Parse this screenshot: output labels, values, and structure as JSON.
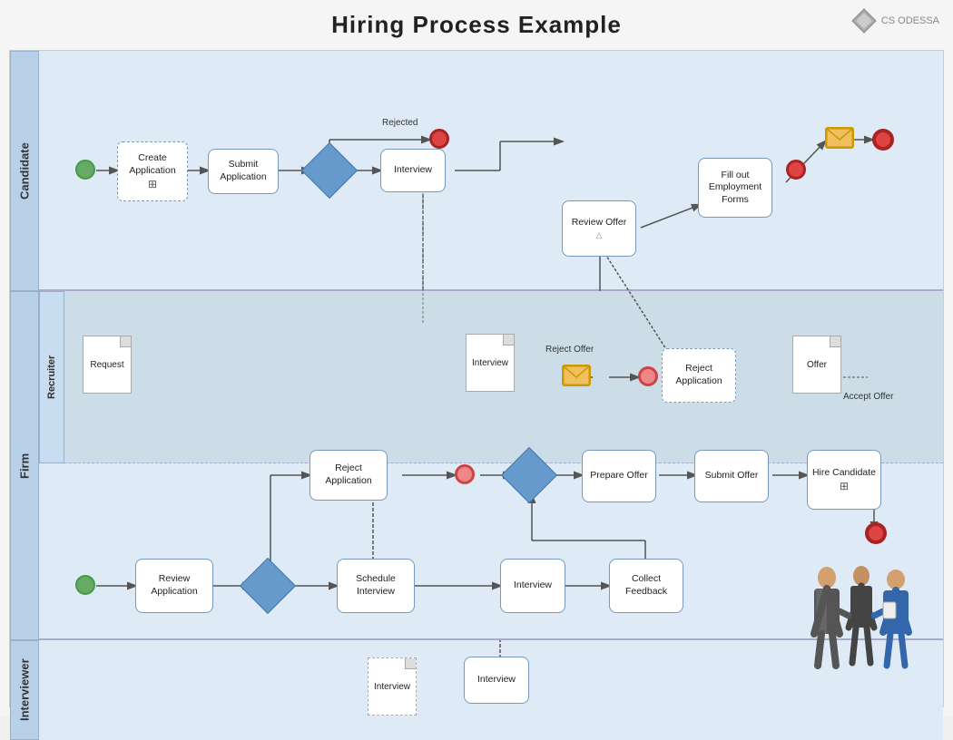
{
  "title": "Hiring Process Example",
  "logo": "CS ODESSA",
  "lanes": {
    "candidate": "Candidate",
    "firm": "Firm",
    "recruiter_sub": "Recruiter",
    "interviewer": "Interviewer"
  },
  "nodes": {
    "create_application": "Create Application",
    "submit_application": "Submit Application",
    "interview_candidate": "Interview",
    "review_offer": "Review Offer",
    "fill_employment_forms": "Fill out Employment Forms",
    "rejected_label": "Rejected",
    "reject_offer_label": "Reject Offer",
    "request": "Request",
    "interview_recruiter": "Interview",
    "reject_application": "Reject Application",
    "reject_application2": "Reject Application",
    "schedule_interview": "Schedule Interview",
    "interview_firm": "Interview",
    "collect_feedback": "Collect Feedback",
    "prepare_offer": "Prepare Offer",
    "submit_offer": "Submit Offer",
    "hire_candidate": "Hire Candidate",
    "offer": "Offer",
    "accept_offer_label": "Accept Offer",
    "interview_interviewer": "Interview",
    "interview_interviewer2": "Interview"
  }
}
